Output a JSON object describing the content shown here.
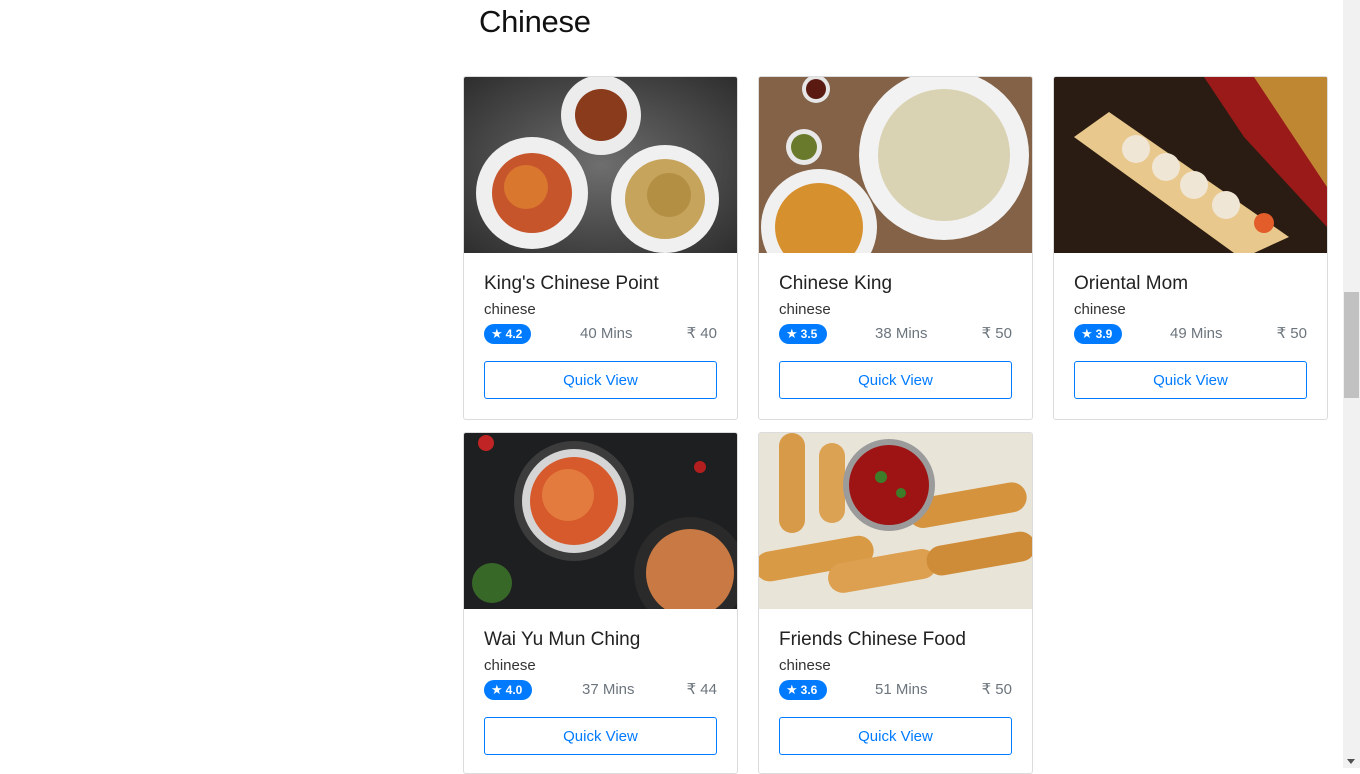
{
  "section": {
    "title": "Chinese"
  },
  "restaurants": [
    {
      "name": "King's Chinese Point",
      "cuisine": "chinese",
      "rating": "4.2",
      "time": "40 Mins",
      "price": "₹ 40",
      "button": "Quick View"
    },
    {
      "name": "Chinese King",
      "cuisine": "chinese",
      "rating": "3.5",
      "time": "38 Mins",
      "price": "₹ 50",
      "button": "Quick View"
    },
    {
      "name": "Oriental Mom",
      "cuisine": "chinese",
      "rating": "3.9",
      "time": "49 Mins",
      "price": "₹ 50",
      "button": "Quick View"
    },
    {
      "name": "Wai Yu Mun Ching",
      "cuisine": "chinese",
      "rating": "4.0",
      "time": "37 Mins",
      "price": "₹ 44",
      "button": "Quick View"
    },
    {
      "name": "Friends Chinese Food",
      "cuisine": "chinese",
      "rating": "3.6",
      "time": "51 Mins",
      "price": "₹ 50",
      "button": "Quick View"
    }
  ],
  "colors": {
    "accent": "#007bff",
    "muted": "#6c757d",
    "border": "#dcdcdc"
  },
  "icons": {
    "rating": "star-icon"
  }
}
